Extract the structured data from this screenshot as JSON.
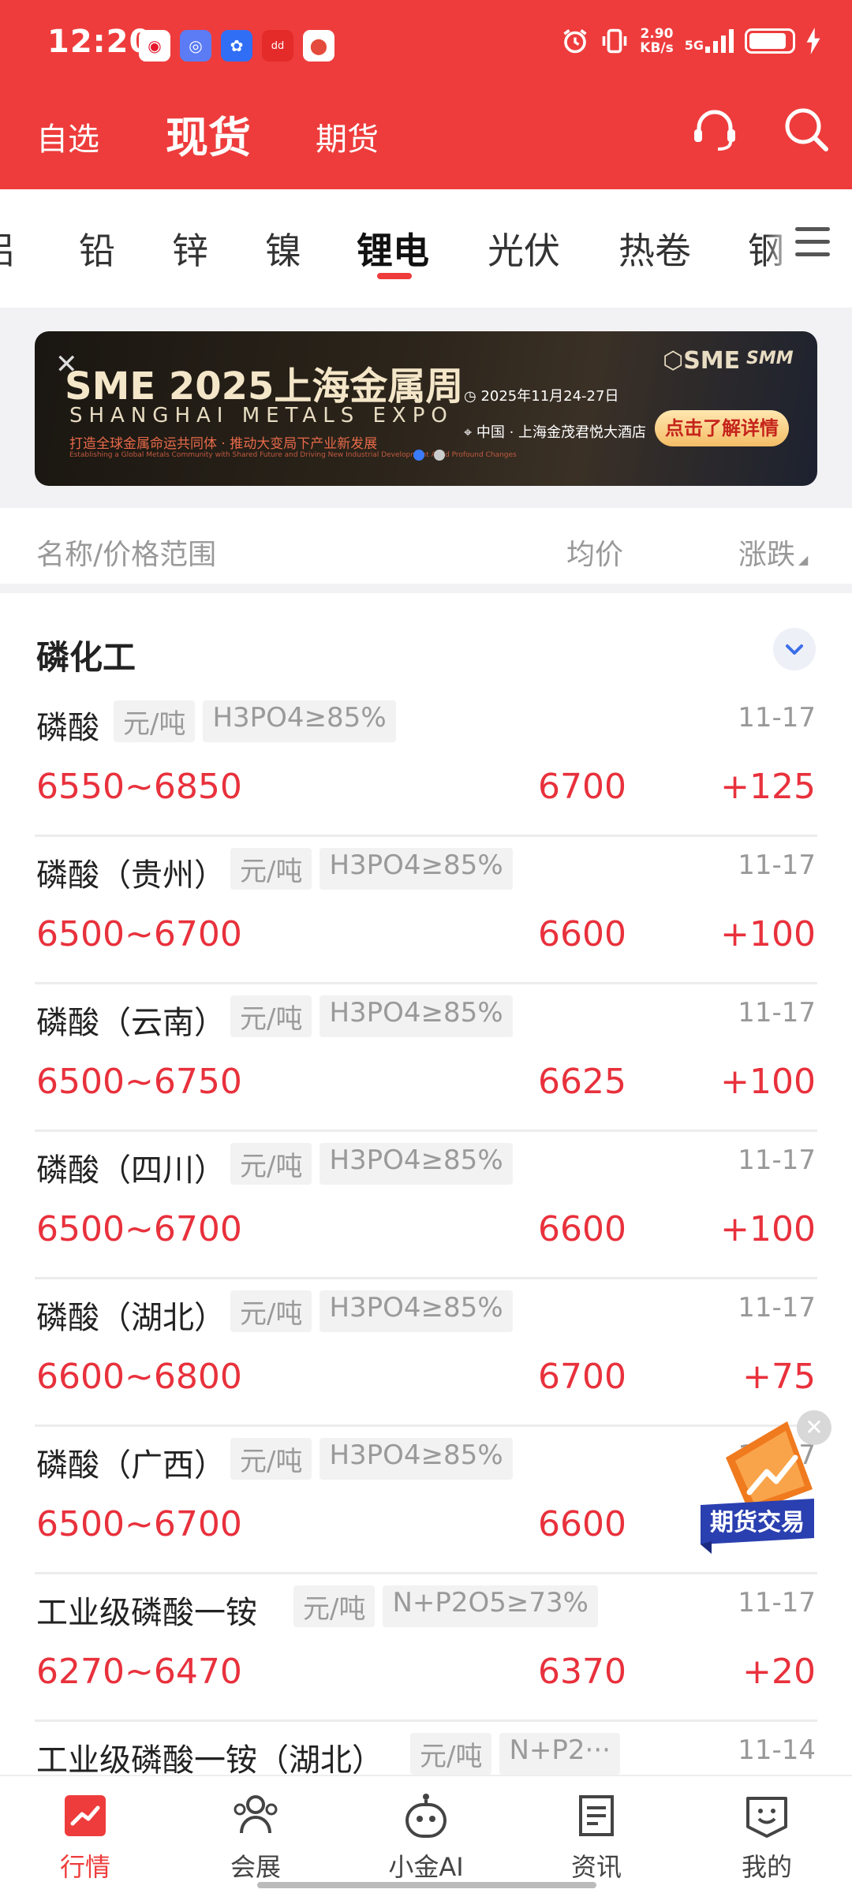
{
  "status_bar": {
    "time": "12:20",
    "net_speed_value": "2.90",
    "net_speed_unit": "KB/s",
    "network": "5G",
    "notif_icons": [
      "weibo-icon",
      "browser-icon",
      "baidu-icon",
      "shopping-icon",
      "map-icon"
    ]
  },
  "header": {
    "tabs": [
      "自选",
      "现货",
      "期货"
    ],
    "active_tab": "现货",
    "icons": [
      "customer-service-icon",
      "search-icon"
    ]
  },
  "category_tabs": {
    "items": [
      "铝",
      "铅",
      "锌",
      "镍",
      "锂电",
      "光伏",
      "热卷",
      "钢"
    ],
    "active": "锂电"
  },
  "banner": {
    "title": "SME 2025上海金属周",
    "subtitle": "SHANGHAI METALS EXPO",
    "slogan": "打造全球金属命运共同体 · 推动大变局下产业新发展",
    "slogan_en": "Establishing a Global Metals Community with Shared Future and Driving New Industrial Development Amid Profound Changes",
    "date": "2025年11月24-27日",
    "venue": "中国 · 上海金茂君悦大酒店",
    "logo_sme": "SME",
    "logo_smm": "SMM",
    "button": "点击了解详情",
    "accent_color": "#3b7cff"
  },
  "columns": {
    "name": "名称/价格范围",
    "avg": "均价",
    "change": "涨跌"
  },
  "group": {
    "title": "磷化工"
  },
  "rows": [
    {
      "name": "磷酸",
      "unit": "元/吨",
      "spec": "H3PO4≥85%",
      "date": "11-17",
      "range": "6550~6850",
      "avg": "6700",
      "change": "+125"
    },
    {
      "name": "磷酸（贵州）",
      "unit": "元/吨",
      "spec": "H3PO4≥85%",
      "date": "11-17",
      "range": "6500~6700",
      "avg": "6600",
      "change": "+100"
    },
    {
      "name": "磷酸（云南）",
      "unit": "元/吨",
      "spec": "H3PO4≥85%",
      "date": "11-17",
      "range": "6500~6750",
      "avg": "6625",
      "change": "+100"
    },
    {
      "name": "磷酸（四川）",
      "unit": "元/吨",
      "spec": "H3PO4≥85%",
      "date": "11-17",
      "range": "6500~6700",
      "avg": "6600",
      "change": "+100"
    },
    {
      "name": "磷酸（湖北）",
      "unit": "元/吨",
      "spec": "H3PO4≥85%",
      "date": "11-17",
      "range": "6600~6800",
      "avg": "6700",
      "change": "+75"
    },
    {
      "name": "磷酸（广西）",
      "unit": "元/吨",
      "spec": "H3PO4≥85%",
      "date": "11-17",
      "range": "6500~6700",
      "avg": "6600",
      "change": ""
    },
    {
      "name": "工业级磷酸一铵",
      "unit": "元/吨",
      "spec": "N+P2O5≥73%",
      "date": "11-17",
      "range": "6270~6470",
      "avg": "6370",
      "change": "+20"
    },
    {
      "name": "工业级磷酸一铵（湖北）",
      "unit": "元/吨",
      "spec": "N+P2···",
      "date": "11-14",
      "range": "",
      "avg": "",
      "change": ""
    }
  ],
  "float_badge": {
    "label": "期货交易"
  },
  "bottom_nav": [
    {
      "label": "行情",
      "icon": "market-chart-icon"
    },
    {
      "label": "会展",
      "icon": "people-icon"
    },
    {
      "label": "小金AI",
      "icon": "robot-icon"
    },
    {
      "label": "资讯",
      "icon": "news-icon"
    },
    {
      "label": "我的",
      "icon": "profile-icon"
    }
  ],
  "colors": {
    "brand_red": "#ee3c3c",
    "price_red": "#e8313c"
  }
}
